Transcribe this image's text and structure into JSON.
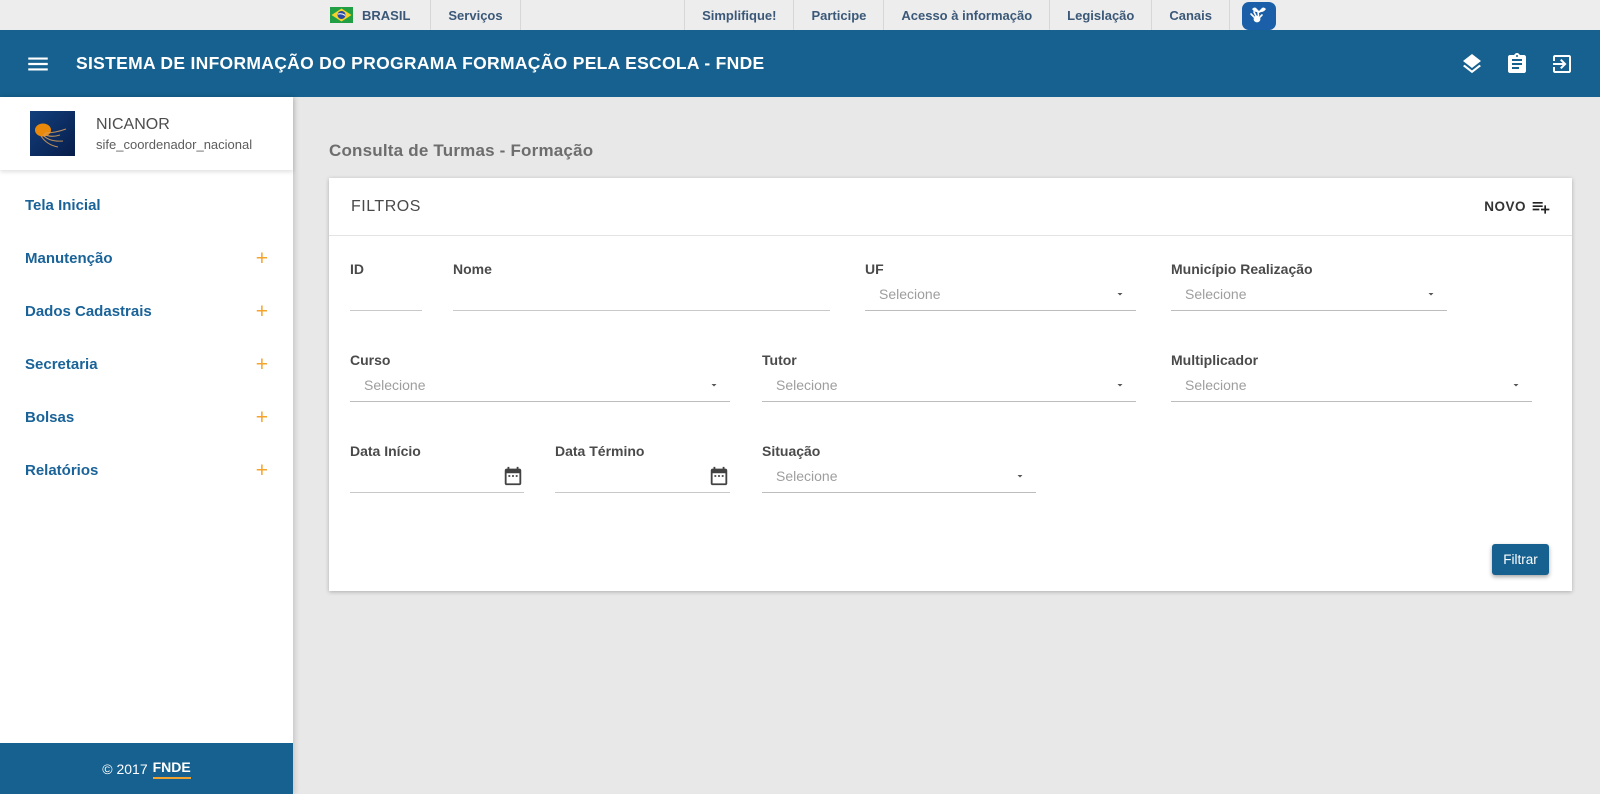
{
  "govbar": {
    "brand": "BRASIL",
    "links_left": [
      "Serviços"
    ],
    "links_right": [
      "Simplifique!",
      "Participe",
      "Acesso à informação",
      "Legislação",
      "Canais"
    ]
  },
  "appbar": {
    "title": "SISTEMA DE INFORMAÇÃO DO PROGRAMA FORMAÇÃO PELA ESCOLA - FNDE",
    "icons": [
      "layers-icon",
      "assignment-icon",
      "exit-icon"
    ]
  },
  "sidebar": {
    "user": {
      "name": "NICANOR",
      "role": "sife_coordenador_nacional"
    },
    "items": [
      {
        "label": "Tela Inicial",
        "expandable": false
      },
      {
        "label": "Manutenção",
        "expandable": true
      },
      {
        "label": "Dados Cadastrais",
        "expandable": true
      },
      {
        "label": "Secretaria",
        "expandable": true
      },
      {
        "label": "Bolsas",
        "expandable": true
      },
      {
        "label": "Relatórios",
        "expandable": true
      }
    ],
    "footer": {
      "copyright": "© 2017",
      "brand": "FNDE"
    }
  },
  "main": {
    "page_title": "Consulta de Turmas - Formação",
    "card": {
      "title": "FILTROS",
      "new_button_label": "NOVO",
      "fields": [
        {
          "label": "ID",
          "type": "text",
          "value": ""
        },
        {
          "label": "Nome",
          "type": "text",
          "value": ""
        },
        {
          "label": "UF",
          "type": "select",
          "placeholder": "Selecione"
        },
        {
          "label": "Município Realização",
          "type": "select",
          "placeholder": "Selecione"
        },
        {
          "label": "Curso",
          "type": "select",
          "placeholder": "Selecione"
        },
        {
          "label": "Tutor",
          "type": "select",
          "placeholder": "Selecione"
        },
        {
          "label": "Multiplicador",
          "type": "select",
          "placeholder": "Selecione"
        },
        {
          "label": "Data Início",
          "type": "date",
          "value": ""
        },
        {
          "label": "Data Término",
          "type": "date",
          "value": ""
        },
        {
          "label": "Situação",
          "type": "select",
          "placeholder": "Selecione"
        }
      ],
      "submit_label": "Filtrar"
    }
  },
  "icons": {
    "expand": "+"
  },
  "colors": {
    "primary_blue": "#16618f",
    "accent_orange": "#f5a42e",
    "govbar_bg": "#ededed",
    "govbar_text": "#3b5878",
    "page_bg": "#e8e8e8",
    "sidebar_link": "#1a6399",
    "vlibras_blue": "#1b5fa8"
  }
}
